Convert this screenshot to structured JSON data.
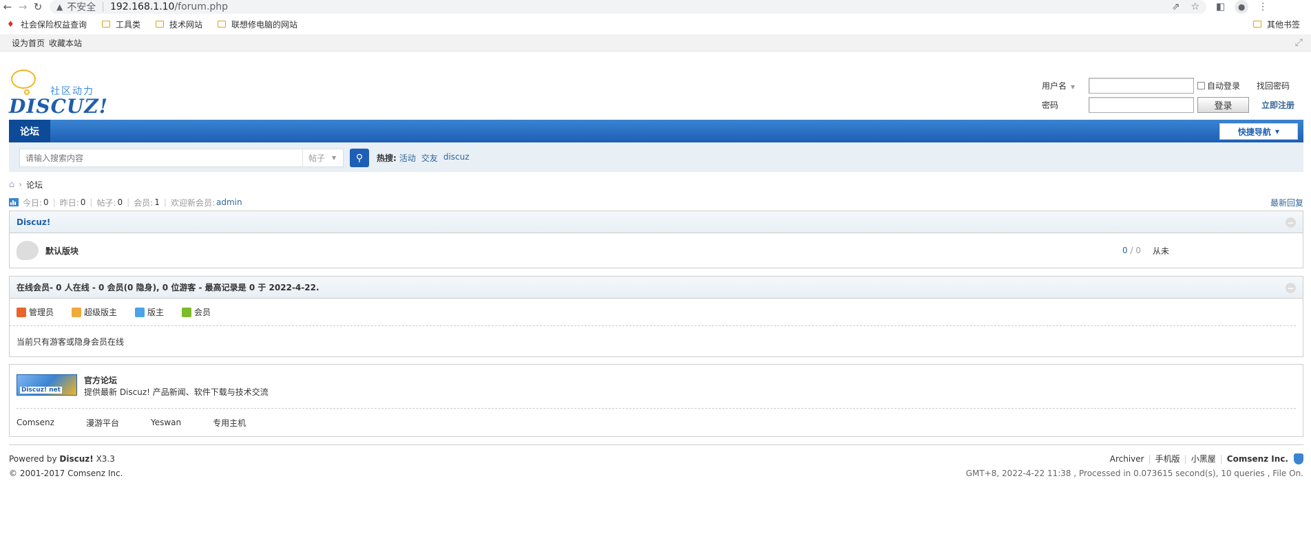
{
  "browser": {
    "insecure_label": "不安全",
    "url_host": "192.168.1.10",
    "url_path": "/forum.php"
  },
  "bookmarks": {
    "items": [
      {
        "label": "社会保险权益查询",
        "icon": "red-bookmark-icon"
      },
      {
        "label": "工具类",
        "icon": "folder-icon"
      },
      {
        "label": "技术网站",
        "icon": "folder-icon"
      },
      {
        "label": "联想修电脑的网站",
        "icon": "folder-icon"
      }
    ],
    "other": "其他书签"
  },
  "toptb": {
    "set_home": "设为首页",
    "bookmark_site": "收藏本站"
  },
  "logo": {
    "community": "社区动力",
    "brand": "DISCUZ!"
  },
  "login": {
    "username_label": "用户名",
    "password_label": "密码",
    "auto_login": "自动登录",
    "find_password": "找回密码",
    "login_button": "登录",
    "register": "立即注册"
  },
  "nav": {
    "forum_tab": "论坛",
    "quick_nav": "快捷导航"
  },
  "search": {
    "placeholder": "请输入搜索内容",
    "type": "帖子",
    "hot_label": "热搜:",
    "hot_items": [
      "活动",
      "交友",
      "discuz"
    ]
  },
  "breadcrumb": {
    "current": "论坛"
  },
  "stats": {
    "today_label": "今日:",
    "today": "0",
    "yesterday_label": "昨日:",
    "yesterday": "0",
    "posts_label": "帖子:",
    "posts": "0",
    "members_label": "会员:",
    "members": "1",
    "welcome_label": "欢迎新会员:",
    "new_member": "admin",
    "latest_reply": "最新回复"
  },
  "category": {
    "name": "Discuz!",
    "forums": [
      {
        "name": "默认版块",
        "threads": "0",
        "posts": "0",
        "last": "从未"
      }
    ]
  },
  "online": {
    "title": "在线会员",
    "summary": " - 0 人在线 - 0 会员(0 隐身), 0 位游客 - 最高记录是 0 于 2022-4-22.",
    "legend": [
      {
        "label": "管理员",
        "color": "#e8662c"
      },
      {
        "label": "超级版主",
        "color": "#f2a93b"
      },
      {
        "label": "版主",
        "color": "#4da3e8"
      },
      {
        "label": "会员",
        "color": "#7dbb2a"
      }
    ],
    "message": "当前只有游客或隐身会员在线"
  },
  "links": {
    "logo_label": "Discuz! net",
    "title": "官方论坛",
    "desc": "提供最新 Discuz! 产品新闻、软件下载与技术交流",
    "text_links": [
      "Comsenz",
      "漫游平台",
      "Yeswan",
      "专用主机"
    ]
  },
  "footer": {
    "powered_prefix": "Powered by",
    "powered_brand": "Discuz!",
    "powered_version": "X3.3",
    "copyright": "© 2001-2017",
    "copyright_company": "Comsenz Inc.",
    "links": [
      "Archiver",
      "手机版",
      "小黑屋"
    ],
    "company": "Comsenz Inc.",
    "processed": "GMT+8, 2022-4-22 11:38 , Processed in 0.073615 second(s), 10 queries , File On."
  }
}
